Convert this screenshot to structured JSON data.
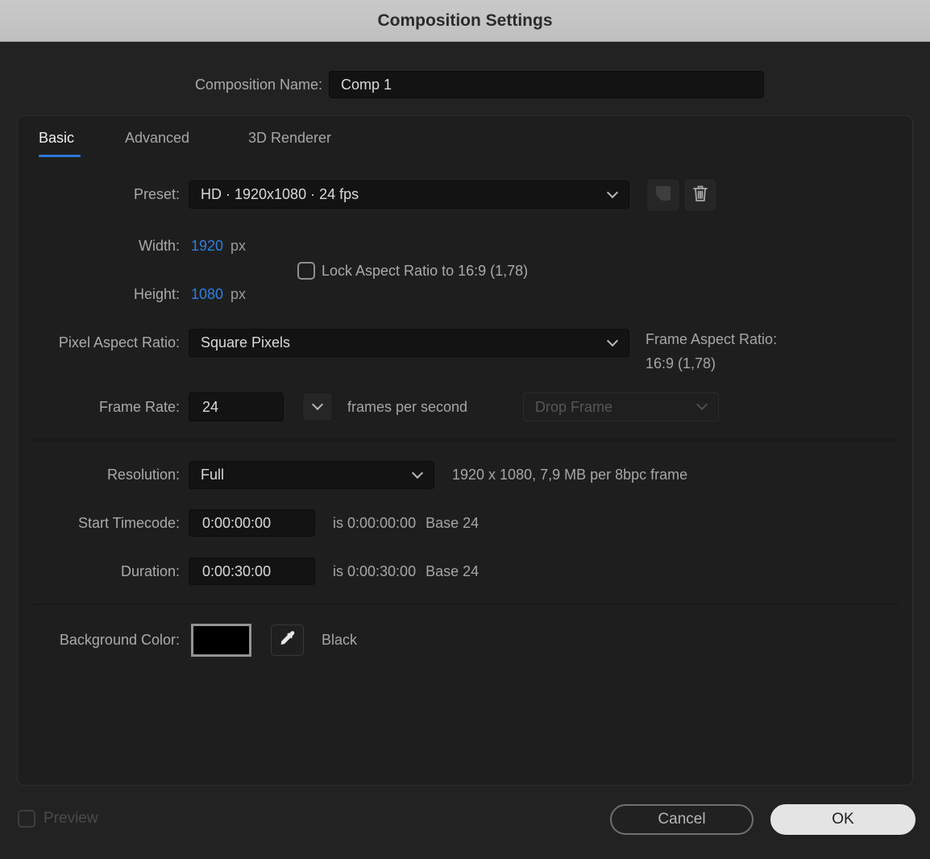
{
  "window": {
    "title": "Composition Settings"
  },
  "colors": {
    "accent_blue": "#2e7fe0",
    "tab_underline": "#2c77d7",
    "background_swatch": "#000000"
  },
  "name_row": {
    "label": "Composition Name:",
    "value": "Comp 1"
  },
  "tabs": {
    "basic": "Basic",
    "advanced": "Advanced",
    "renderer": "3D Renderer"
  },
  "preset": {
    "label": "Preset:",
    "value": "HD  ·  1920x1080 · 24 fps"
  },
  "size": {
    "width_label": "Width:",
    "width_value": "1920",
    "width_unit": "px",
    "height_label": "Height:",
    "height_value": "1080",
    "height_unit": "px",
    "lock_label": "Lock Aspect Ratio to 16:9 (1,78)"
  },
  "pixel_aspect": {
    "label": "Pixel Aspect Ratio:",
    "value": "Square Pixels"
  },
  "frame_aspect": {
    "label": "Frame Aspect Ratio:",
    "value": "16:9 (1,78)"
  },
  "frame_rate": {
    "label": "Frame Rate:",
    "value": "24",
    "unit": "frames per second",
    "drop_frame": "Drop Frame"
  },
  "resolution": {
    "label": "Resolution:",
    "value": "Full",
    "info": "1920 x 1080, 7,9 MB per 8bpc frame"
  },
  "start_timecode": {
    "label": "Start Timecode:",
    "value": "0:00:00:00",
    "is_text": "is 0:00:00:00",
    "base_text": "Base 24"
  },
  "duration": {
    "label": "Duration:",
    "value": "0:00:30:00",
    "is_text": "is 0:00:30:00",
    "base_text": "Base 24"
  },
  "background": {
    "label": "Background Color:",
    "color_name": "Black"
  },
  "footer": {
    "preview": "Preview",
    "cancel": "Cancel",
    "ok": "OK"
  }
}
